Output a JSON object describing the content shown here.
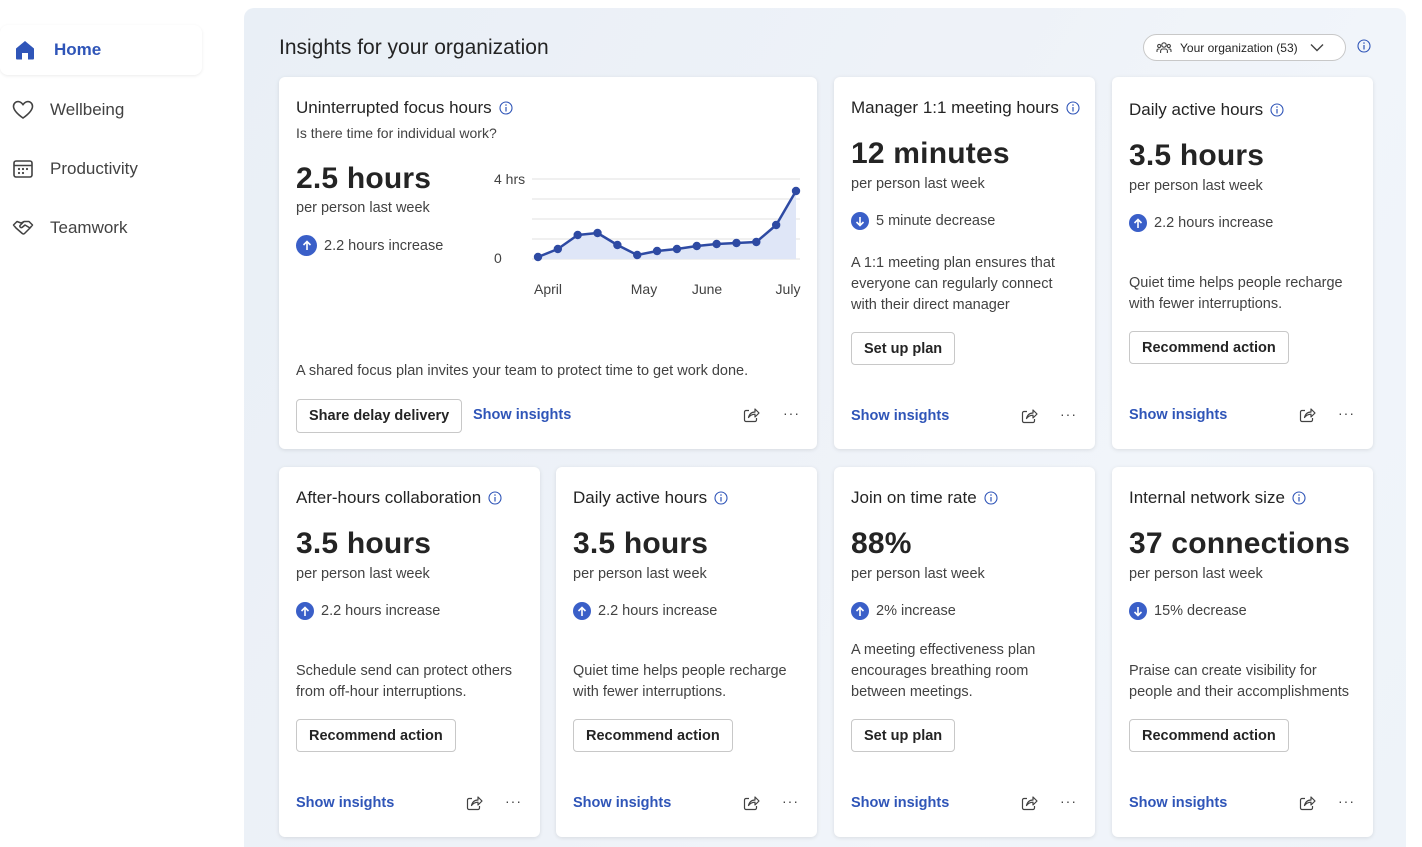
{
  "sidebar": {
    "items": [
      {
        "label": "Home",
        "icon": "home-icon",
        "active": true
      },
      {
        "label": "Wellbeing",
        "icon": "heart-icon"
      },
      {
        "label": "Productivity",
        "icon": "calendar-icon"
      },
      {
        "label": "Teamwork",
        "icon": "handshake-icon"
      }
    ]
  },
  "header": {
    "title": "Insights for your organization",
    "org_select": "Your organization (53)"
  },
  "common": {
    "per": "per person last week",
    "show_insights": "Show insights",
    "more": "···"
  },
  "cards": {
    "focus": {
      "title": "Uninterrupted focus hours",
      "subtitle": "Is there time for individual work?",
      "value": "2.5 hours",
      "trend": "2.2 hours increase",
      "trend_dir": "up",
      "description": "A shared focus plan invites your team to protect time to get work done.",
      "button": "Share delay delivery"
    },
    "manager": {
      "title": "Manager 1:1 meeting hours",
      "value": "12 minutes",
      "trend": "5 minute decrease",
      "trend_dir": "down",
      "description_lines": [
        "A 1:1 meeting plan ensures that",
        "everyone can regularly connect",
        "with their direct manager"
      ],
      "button": "Set up plan"
    },
    "daily_top": {
      "title": "Daily active hours",
      "value": "3.5 hours",
      "trend": "2.2 hours increase",
      "trend_dir": "up",
      "description_lines": [
        "Quiet time helps people recharge",
        "with fewer interruptions."
      ],
      "button": "Recommend action"
    },
    "after_hours": {
      "title": "After-hours collaboration",
      "value": "3.5 hours",
      "trend": "2.2 hours increase",
      "trend_dir": "up",
      "description_lines": [
        "Schedule send can protect others",
        "from off-hour interruptions."
      ],
      "button": "Recommend action"
    },
    "daily_bottom": {
      "title": "Daily active hours",
      "value": "3.5 hours",
      "trend": "2.2 hours increase",
      "trend_dir": "up",
      "description_lines": [
        "Quiet time helps people recharge",
        "with fewer interruptions."
      ],
      "button": "Recommend action"
    },
    "join_time": {
      "title": "Join on time rate",
      "value": "88%",
      "trend": "2% increase",
      "trend_dir": "up",
      "description_lines": [
        "A meeting effectiveness plan",
        "encourages breathing room",
        "between meetings."
      ],
      "button": "Set up plan"
    },
    "network": {
      "title": "Internal network size",
      "value": "37 connections",
      "trend": "15% decrease",
      "trend_dir": "down",
      "description_lines": [
        "Praise can create visibility for",
        "people and their accomplishments"
      ],
      "button": "Recommend action"
    }
  },
  "chart_data": {
    "type": "area",
    "title": "",
    "xlabel": "",
    "ylabel": "",
    "x_tick_labels": [
      "April",
      "May",
      "June",
      "July"
    ],
    "y_tick_labels": [
      "4 hrs",
      "0"
    ],
    "ylim": [
      0,
      4
    ],
    "grid": true,
    "series": [
      {
        "values": [
          0.1,
          0.5,
          1.2,
          1.3,
          0.7,
          0.2,
          0.4,
          0.5,
          0.65,
          0.75,
          0.8,
          0.85,
          1.7,
          3.4
        ]
      }
    ],
    "colors": {
      "line": "#2e4aa3",
      "fill": "#dfe6f7"
    }
  }
}
